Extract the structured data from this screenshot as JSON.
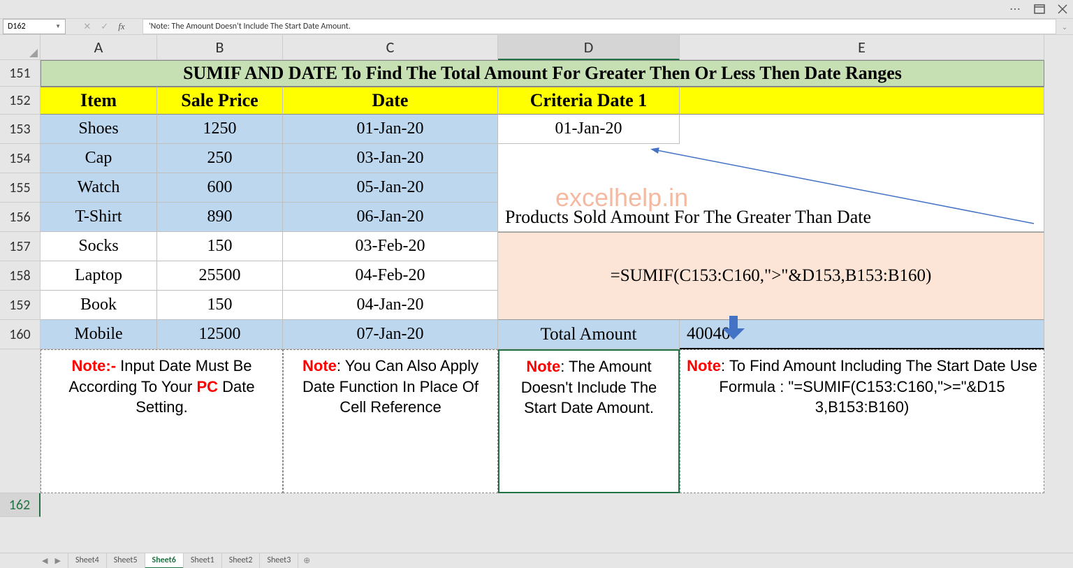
{
  "title_icons": {
    "dots": "⋯"
  },
  "name_box": "D162",
  "formula_bar": "'Note: The Amount Doesn't Include The Start Date Amount.",
  "columns": [
    "A",
    "B",
    "C",
    "D",
    "E"
  ],
  "rows": [
    "151",
    "152",
    "153",
    "154",
    "155",
    "156",
    "157",
    "158",
    "159",
    "160",
    "",
    "162"
  ],
  "title_row": "SUMIF AND DATE To Find The Total Amount For Greater Then Or Less Then Date Ranges",
  "headers": {
    "item": "Item",
    "price": "Sale Price",
    "date": "Date",
    "crit": "Criteria Date 1"
  },
  "data": [
    {
      "item": "Shoes",
      "price": "1250",
      "date": "01-Jan-20",
      "blue": true
    },
    {
      "item": "Cap",
      "price": "250",
      "date": "03-Jan-20",
      "blue": true
    },
    {
      "item": "Watch",
      "price": "600",
      "date": "05-Jan-20",
      "blue": true
    },
    {
      "item": "T-Shirt",
      "price": "890",
      "date": "06-Jan-20",
      "blue": true
    },
    {
      "item": "Socks",
      "price": "150",
      "date": "03-Feb-20",
      "blue": false
    },
    {
      "item": "Laptop",
      "price": "25500",
      "date": "04-Feb-20",
      "blue": false
    },
    {
      "item": "Book",
      "price": "150",
      "date": "04-Jan-20",
      "blue": false
    },
    {
      "item": "Mobile",
      "price": "12500",
      "date": "07-Jan-20",
      "blue": true
    }
  ],
  "crit_date": "01-Jan-20",
  "subtitle": "Products Sold Amount For The Greater Than Date",
  "formula_display": "=SUMIF(C153:C160,\">\"&D153,B153:B160)",
  "total_label": "Total Amount",
  "total_value": "40040",
  "watermark": "excelhelp.in",
  "notes": {
    "n1_pre": "Note:-",
    "n1_body": " Input Date Must Be According To Your ",
    "n1_pc": "PC",
    "n1_tail": " Date Setting.",
    "n2_pre": "Note",
    "n2_body": ": You Can Also Apply Date Function In Place Of Cell Reference",
    "n3_pre": "Note",
    "n3_body": ": The Amount Doesn't Include The Start Date Amount.",
    "n4_pre": "Note",
    "n4_body": ": To Find Amount Including The Start Date Use Formula : \"=SUMIF(C153:C160,\">=\"&D15 3,B153:B160)"
  },
  "tabs": [
    "Sheet4",
    "Sheet5",
    "Sheet6",
    "Sheet1",
    "Sheet2",
    "Sheet3"
  ],
  "active_tab": "Sheet6"
}
